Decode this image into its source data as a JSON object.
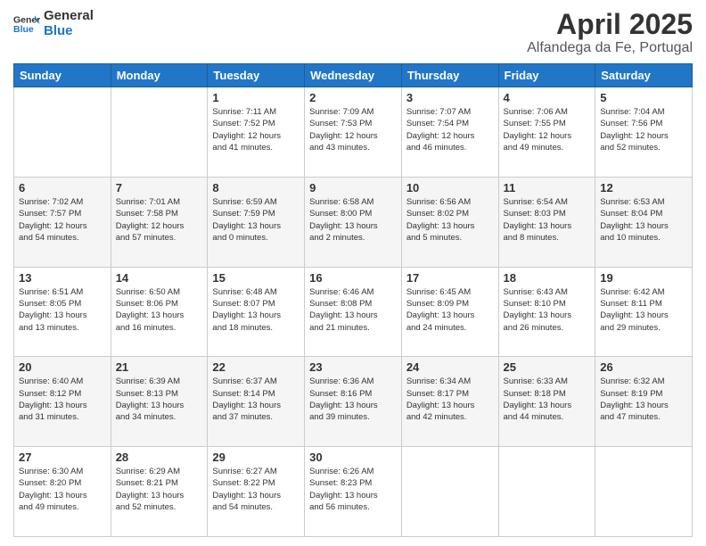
{
  "logo": {
    "line1": "General",
    "line2": "Blue"
  },
  "title": "April 2025",
  "subtitle": "Alfandega da Fe, Portugal",
  "weekdays": [
    "Sunday",
    "Monday",
    "Tuesday",
    "Wednesday",
    "Thursday",
    "Friday",
    "Saturday"
  ],
  "weeks": [
    [
      {
        "day": "",
        "info": ""
      },
      {
        "day": "",
        "info": ""
      },
      {
        "day": "1",
        "info": "Sunrise: 7:11 AM\nSunset: 7:52 PM\nDaylight: 12 hours\nand 41 minutes."
      },
      {
        "day": "2",
        "info": "Sunrise: 7:09 AM\nSunset: 7:53 PM\nDaylight: 12 hours\nand 43 minutes."
      },
      {
        "day": "3",
        "info": "Sunrise: 7:07 AM\nSunset: 7:54 PM\nDaylight: 12 hours\nand 46 minutes."
      },
      {
        "day": "4",
        "info": "Sunrise: 7:06 AM\nSunset: 7:55 PM\nDaylight: 12 hours\nand 49 minutes."
      },
      {
        "day": "5",
        "info": "Sunrise: 7:04 AM\nSunset: 7:56 PM\nDaylight: 12 hours\nand 52 minutes."
      }
    ],
    [
      {
        "day": "6",
        "info": "Sunrise: 7:02 AM\nSunset: 7:57 PM\nDaylight: 12 hours\nand 54 minutes."
      },
      {
        "day": "7",
        "info": "Sunrise: 7:01 AM\nSunset: 7:58 PM\nDaylight: 12 hours\nand 57 minutes."
      },
      {
        "day": "8",
        "info": "Sunrise: 6:59 AM\nSunset: 7:59 PM\nDaylight: 13 hours\nand 0 minutes."
      },
      {
        "day": "9",
        "info": "Sunrise: 6:58 AM\nSunset: 8:00 PM\nDaylight: 13 hours\nand 2 minutes."
      },
      {
        "day": "10",
        "info": "Sunrise: 6:56 AM\nSunset: 8:02 PM\nDaylight: 13 hours\nand 5 minutes."
      },
      {
        "day": "11",
        "info": "Sunrise: 6:54 AM\nSunset: 8:03 PM\nDaylight: 13 hours\nand 8 minutes."
      },
      {
        "day": "12",
        "info": "Sunrise: 6:53 AM\nSunset: 8:04 PM\nDaylight: 13 hours\nand 10 minutes."
      }
    ],
    [
      {
        "day": "13",
        "info": "Sunrise: 6:51 AM\nSunset: 8:05 PM\nDaylight: 13 hours\nand 13 minutes."
      },
      {
        "day": "14",
        "info": "Sunrise: 6:50 AM\nSunset: 8:06 PM\nDaylight: 13 hours\nand 16 minutes."
      },
      {
        "day": "15",
        "info": "Sunrise: 6:48 AM\nSunset: 8:07 PM\nDaylight: 13 hours\nand 18 minutes."
      },
      {
        "day": "16",
        "info": "Sunrise: 6:46 AM\nSunset: 8:08 PM\nDaylight: 13 hours\nand 21 minutes."
      },
      {
        "day": "17",
        "info": "Sunrise: 6:45 AM\nSunset: 8:09 PM\nDaylight: 13 hours\nand 24 minutes."
      },
      {
        "day": "18",
        "info": "Sunrise: 6:43 AM\nSunset: 8:10 PM\nDaylight: 13 hours\nand 26 minutes."
      },
      {
        "day": "19",
        "info": "Sunrise: 6:42 AM\nSunset: 8:11 PM\nDaylight: 13 hours\nand 29 minutes."
      }
    ],
    [
      {
        "day": "20",
        "info": "Sunrise: 6:40 AM\nSunset: 8:12 PM\nDaylight: 13 hours\nand 31 minutes."
      },
      {
        "day": "21",
        "info": "Sunrise: 6:39 AM\nSunset: 8:13 PM\nDaylight: 13 hours\nand 34 minutes."
      },
      {
        "day": "22",
        "info": "Sunrise: 6:37 AM\nSunset: 8:14 PM\nDaylight: 13 hours\nand 37 minutes."
      },
      {
        "day": "23",
        "info": "Sunrise: 6:36 AM\nSunset: 8:16 PM\nDaylight: 13 hours\nand 39 minutes."
      },
      {
        "day": "24",
        "info": "Sunrise: 6:34 AM\nSunset: 8:17 PM\nDaylight: 13 hours\nand 42 minutes."
      },
      {
        "day": "25",
        "info": "Sunrise: 6:33 AM\nSunset: 8:18 PM\nDaylight: 13 hours\nand 44 minutes."
      },
      {
        "day": "26",
        "info": "Sunrise: 6:32 AM\nSunset: 8:19 PM\nDaylight: 13 hours\nand 47 minutes."
      }
    ],
    [
      {
        "day": "27",
        "info": "Sunrise: 6:30 AM\nSunset: 8:20 PM\nDaylight: 13 hours\nand 49 minutes."
      },
      {
        "day": "28",
        "info": "Sunrise: 6:29 AM\nSunset: 8:21 PM\nDaylight: 13 hours\nand 52 minutes."
      },
      {
        "day": "29",
        "info": "Sunrise: 6:27 AM\nSunset: 8:22 PM\nDaylight: 13 hours\nand 54 minutes."
      },
      {
        "day": "30",
        "info": "Sunrise: 6:26 AM\nSunset: 8:23 PM\nDaylight: 13 hours\nand 56 minutes."
      },
      {
        "day": "",
        "info": ""
      },
      {
        "day": "",
        "info": ""
      },
      {
        "day": "",
        "info": ""
      }
    ]
  ]
}
